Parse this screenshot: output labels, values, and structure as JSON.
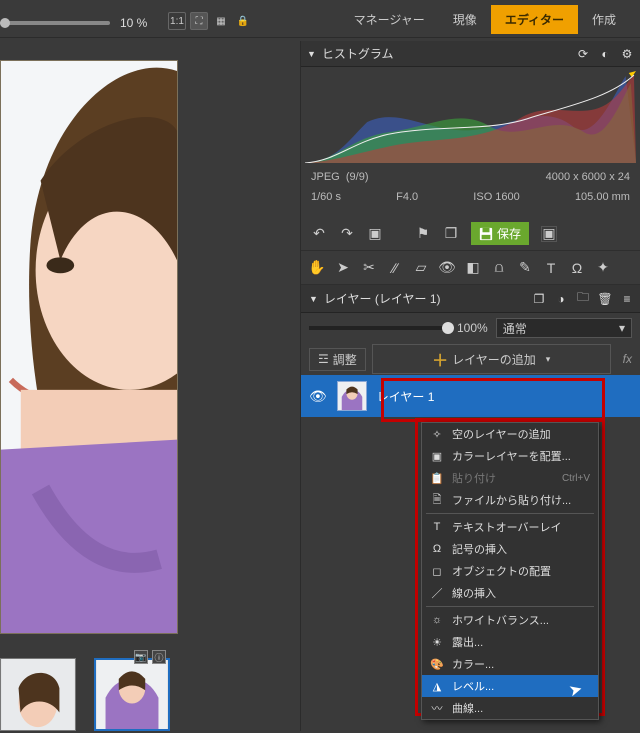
{
  "topbar": {
    "zoom_label": "10 %",
    "tabs": {
      "manager": "マネージャー",
      "develop": "現像",
      "editor": "エディター",
      "create": "作成"
    }
  },
  "histogram_panel": {
    "title": "ヒストグラム"
  },
  "meta": {
    "format": "JPEG",
    "index": "(9/9)",
    "dimensions": "4000 x 6000 x 24",
    "shutter": "1/60 s",
    "aperture": "F4.0",
    "iso": "ISO 1600",
    "focal": "105.00 mm"
  },
  "actions": {
    "save_label": "保存"
  },
  "layers": {
    "panel_title": "レイヤー (レイヤー 1)",
    "opacity_label": "100%",
    "blend_mode": "通常",
    "adjust_label": "調整",
    "add_label": "レイヤーの追加",
    "fx_label": "fx",
    "layer1_name": "レイヤー 1"
  },
  "menu": {
    "empty_layer": "空のレイヤーの追加",
    "color_layer": "カラーレイヤーを配置...",
    "paste": "貼り付け",
    "paste_shortcut": "Ctrl+V",
    "paste_file": "ファイルから貼り付け...",
    "text_overlay": "テキストオーバーレイ",
    "symbol_insert": "記号の挿入",
    "object_place": "オブジェクトの配置",
    "line_insert": "線の挿入",
    "white_balance": "ホワイトバランス...",
    "exposure": "露出...",
    "color": "カラー...",
    "levels": "レベル...",
    "curves": "曲線..."
  }
}
